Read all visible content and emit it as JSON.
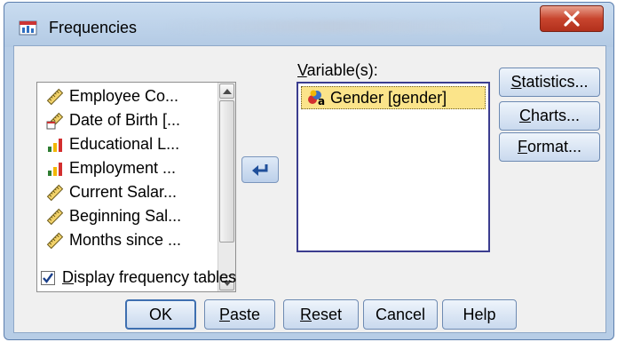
{
  "window": {
    "title": "Frequencies"
  },
  "source_list": {
    "items": [
      {
        "label": "Employee Co...",
        "icon": "scale-ruler-icon"
      },
      {
        "label": "Date of Birth [...",
        "icon": "date-scale-icon"
      },
      {
        "label": "Educational L...",
        "icon": "ordinal-bars-icon"
      },
      {
        "label": "Employment ...",
        "icon": "ordinal-bars-icon"
      },
      {
        "label": "Current Salar...",
        "icon": "scale-ruler-icon"
      },
      {
        "label": "Beginning Sal...",
        "icon": "scale-ruler-icon"
      },
      {
        "label": "Months since ...",
        "icon": "scale-ruler-icon"
      }
    ]
  },
  "target": {
    "label_prefix": "V",
    "label_rest": "ariable(s):",
    "items": [
      {
        "label": "Gender [gender]",
        "icon": "nominal-string-icon"
      }
    ]
  },
  "side_buttons": {
    "statistics_ul": "S",
    "statistics_rest": "tatistics...",
    "charts_ul": "C",
    "charts_rest": "harts...",
    "format_ul": "F",
    "format_rest": "ormat..."
  },
  "options": {
    "display_tables_ul": "D",
    "display_tables_rest": "isplay frequency tables",
    "display_tables_checked": true
  },
  "buttons": {
    "ok": "OK",
    "paste_ul": "P",
    "paste_rest": "aste",
    "reset_ul": "R",
    "reset_rest": "eset",
    "cancel": "Cancel",
    "help": "Help"
  },
  "colors": {
    "chrome": "#b7cde6",
    "selection": "#fbe48a",
    "close_button": "#c8452e"
  }
}
